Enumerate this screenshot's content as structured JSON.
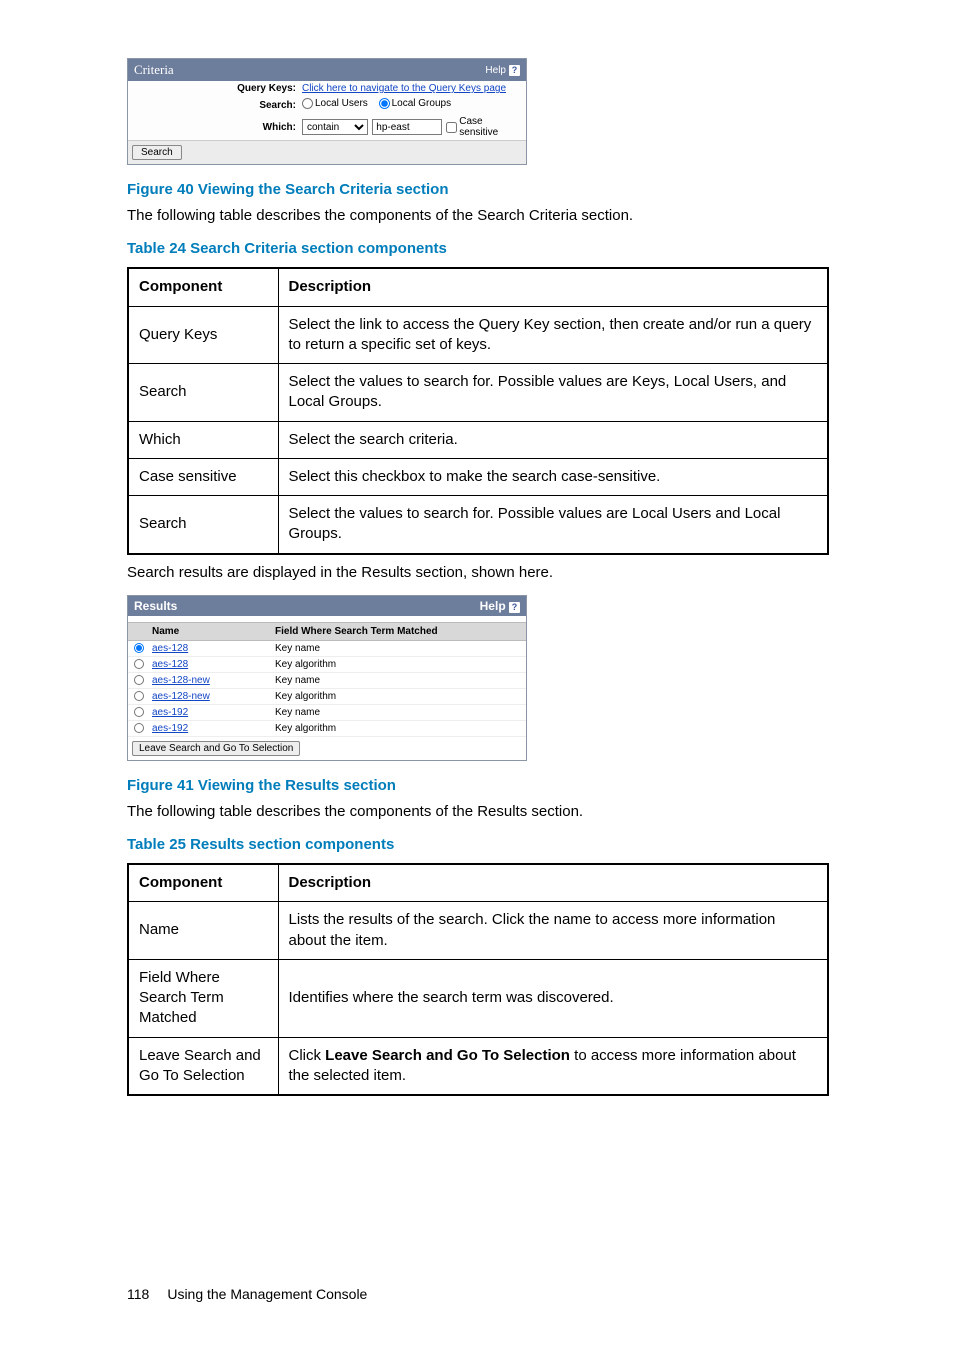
{
  "criteria": {
    "title": "Criteria",
    "help": "Help",
    "rows": {
      "querykeys_label": "Query Keys:",
      "querykeys_link": "Click here to navigate to the Query Keys page",
      "search_label": "Search:",
      "radio1": "Local Users",
      "radio2": "Local Groups",
      "which_label": "Which:",
      "which_select": "contain",
      "which_text": "hp-east",
      "cs_label": "Case sensitive"
    },
    "search_btn": "Search"
  },
  "fig40": "Figure 40 Viewing the Search Criteria section",
  "p40": "The following table describes the components of the Search Criteria section.",
  "tbl24_caption": "Table 24 Search Criteria section components",
  "tbl24": {
    "headers": [
      "Component",
      "Description"
    ],
    "rows": [
      [
        "Query Keys",
        "Select the link to access the Query Key section, then create and/or run a query to return a specific set of keys."
      ],
      [
        "Search",
        "Select the values to search for. Possible values are Keys, Local Users, and Local Groups."
      ],
      [
        "Which",
        "Select the search criteria."
      ],
      [
        "Case sensitive",
        "Select this checkbox to make the search case-sensitive."
      ],
      [
        "Search",
        "Select the values to search for. Possible values are Local Users and Local Groups."
      ]
    ]
  },
  "p_results_intro": "Search results are displayed in the Results section, shown here.",
  "results": {
    "title": "Results",
    "help": "Help",
    "col1": "Name",
    "col2": "Field Where Search Term Matched",
    "rows": [
      {
        "name": "aes-128",
        "field": "Key name",
        "sel": true
      },
      {
        "name": "aes-128",
        "field": "Key algorithm",
        "sel": false
      },
      {
        "name": "aes-128-new",
        "field": "Key name",
        "sel": false
      },
      {
        "name": "aes-128-new",
        "field": "Key algorithm",
        "sel": false
      },
      {
        "name": "aes-192",
        "field": "Key name",
        "sel": false
      },
      {
        "name": "aes-192",
        "field": "Key algorithm",
        "sel": false
      }
    ],
    "footer_btn": "Leave Search and Go To Selection"
  },
  "fig41": "Figure 41 Viewing the Results section",
  "p41": "The following table describes the components of the Results section.",
  "tbl25_caption": "Table 25 Results section components",
  "tbl25": {
    "headers": [
      "Component",
      "Description"
    ],
    "rows": [
      [
        "Name",
        "Lists the results of the search. Click the name to access more information about the item."
      ],
      [
        "Field Where Search Term Matched",
        "Identifies where the search term was discovered."
      ],
      [
        "Leave Search and Go To Selection",
        "Click <b>Leave Search and Go To Selection</b> to access more information about the selected item."
      ]
    ]
  },
  "footer": {
    "page": "118",
    "section": "Using the Management Console"
  }
}
